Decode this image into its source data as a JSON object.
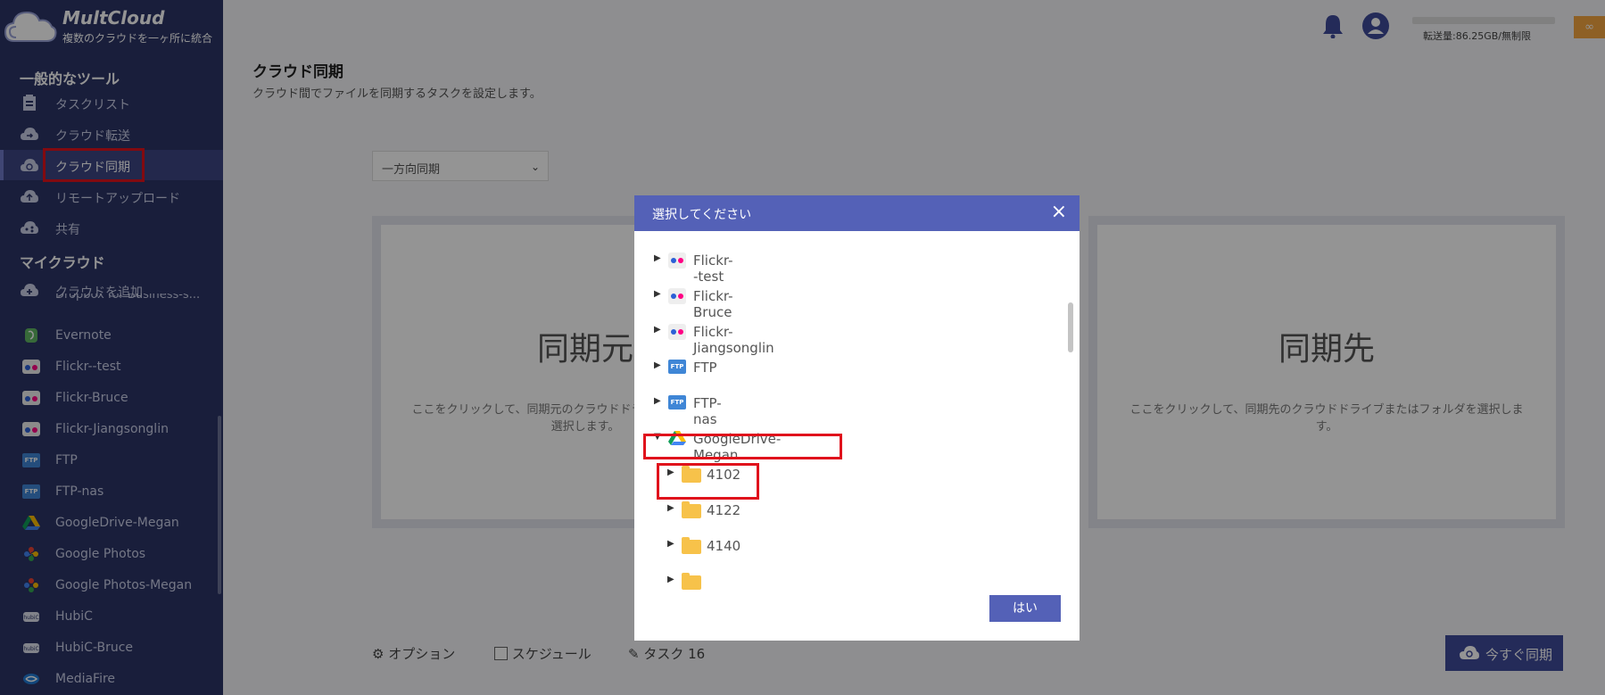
{
  "brand": {
    "name": "MultCloud",
    "tagline": "複数のクラウドを一ヶ所に統合"
  },
  "sidebar": {
    "section_tools": "一般的なツール",
    "tools": [
      {
        "label": "タスクリスト",
        "icon": "clipboard-icon"
      },
      {
        "label": "クラウド転送",
        "icon": "cloud-transfer-icon"
      },
      {
        "label": "クラウド同期",
        "icon": "cloud-sync-icon",
        "active": true
      },
      {
        "label": "リモートアップロード",
        "icon": "cloud-upload-icon"
      },
      {
        "label": "共有",
        "icon": "cloud-share-icon"
      }
    ],
    "section_clouds": "マイクラウド",
    "add_cloud": "クラウドを追加",
    "partial_item": "Dropbox for Business-s...",
    "clouds": [
      {
        "label": "Evernote",
        "icon": "evernote-icon"
      },
      {
        "label": "Flickr--test",
        "icon": "flickr-icon"
      },
      {
        "label": "Flickr-Bruce",
        "icon": "flickr-icon"
      },
      {
        "label": "Flickr-Jiangsonglin",
        "icon": "flickr-icon"
      },
      {
        "label": "FTP",
        "icon": "ftp-icon"
      },
      {
        "label": "FTP-nas",
        "icon": "ftp-icon"
      },
      {
        "label": "GoogleDrive-Megan",
        "icon": "google-drive-icon"
      },
      {
        "label": "Google Photos",
        "icon": "google-photos-icon"
      },
      {
        "label": "Google Photos-Megan",
        "icon": "google-photos-icon"
      },
      {
        "label": "HubiC",
        "icon": "hubic-icon"
      },
      {
        "label": "HubiC-Bruce",
        "icon": "hubic-icon"
      },
      {
        "label": "MediaFire",
        "icon": "mediafire-icon"
      }
    ]
  },
  "topbar": {
    "quota": "転送量:86.25GB/無制限",
    "badge": "∞"
  },
  "main": {
    "title": "クラウド同期",
    "subtitle": "クラウド間でファイルを同期するタスクを設定します。",
    "sync_mode": "一方向同期",
    "source": {
      "title": "同期元",
      "desc": "ここをクリックして、同期元のクラウドドライブまたはフォルダを選択します。"
    },
    "target": {
      "title": "同期先",
      "desc": "ここをクリックして、同期先のクラウドドライブまたはフォルダを選択します。"
    },
    "options_label": "オプション",
    "schedule_label": "スケジュール",
    "task_label": "タスク 16",
    "sync_now_label": "今すぐ同期"
  },
  "modal": {
    "title": "選択してください",
    "close": "×",
    "ok_label": "はい",
    "tree": [
      {
        "label": "Flickr--test",
        "icon": "flickr-icon",
        "level": 0
      },
      {
        "label": "Flickr-Bruce",
        "icon": "flickr-icon",
        "level": 0
      },
      {
        "label": "Flickr-Jiangsonglin",
        "icon": "flickr-icon",
        "level": 0
      },
      {
        "label": "FTP",
        "icon": "ftp-icon",
        "level": 0
      },
      {
        "label": "FTP-nas",
        "icon": "ftp-icon",
        "level": 0
      },
      {
        "label": "GoogleDrive-Megan",
        "icon": "google-drive-icon",
        "level": 0,
        "expanded": true
      },
      {
        "label": "4102",
        "icon": "folder-icon",
        "level": 1
      },
      {
        "label": "4122",
        "icon": "folder-icon",
        "level": 1
      },
      {
        "label": "4140",
        "icon": "folder-icon",
        "level": 1
      }
    ]
  }
}
